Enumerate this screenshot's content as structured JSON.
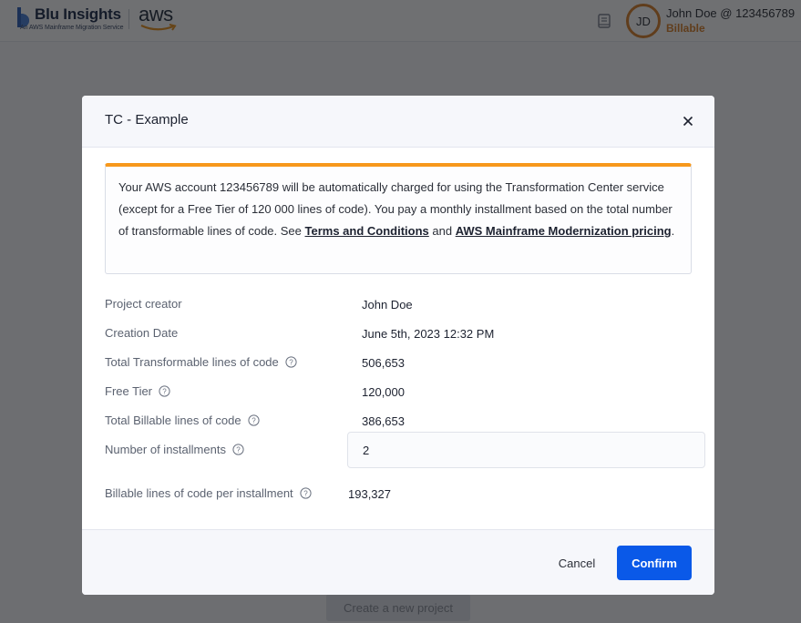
{
  "app": {
    "brand": {
      "title": "Blu Insights",
      "subtitle": "An AWS Mainframe Migration Service",
      "partner_logo": "aws"
    },
    "user": {
      "initials": "JD",
      "name": "John Doe @ 123456789",
      "status": "Billable",
      "status_color": "#d9812a"
    },
    "background_button": "Create a new project"
  },
  "modal": {
    "title": "TC - Example",
    "close_icon": "close-icon",
    "notice": {
      "text_before": "Your AWS account 123456789 will be automatically charged for using the Transformation Center service (except for a Free Tier of 120 000 lines of code). You pay a monthly installment based on the total number of transformable lines of code. See ",
      "link1": "Terms and Conditions",
      "text_between": " and ",
      "link2": "AWS Mainframe Modernization pricing",
      "text_after": ".",
      "accent_color": "#f7981c"
    },
    "details": [
      {
        "label": "Project creator",
        "value": "John Doe",
        "help": false
      },
      {
        "label": "Creation Date",
        "value": "June 5th, 2023 12:32 PM",
        "help": false
      },
      {
        "label": "Total Transformable lines of code",
        "value": "506,653",
        "help": true
      },
      {
        "label": "Free Tier",
        "value": "120,000",
        "help": true
      },
      {
        "label": "Total Billable lines of code",
        "value": "386,653",
        "help": true
      }
    ],
    "installments": {
      "label": "Number of installments",
      "value": "2"
    },
    "per_installment": {
      "label": "Billable lines of code per installment",
      "value": "193,327"
    },
    "footer": {
      "cancel_label": "Cancel",
      "confirm_label": "Confirm",
      "confirm_color": "#0a59e8"
    }
  }
}
